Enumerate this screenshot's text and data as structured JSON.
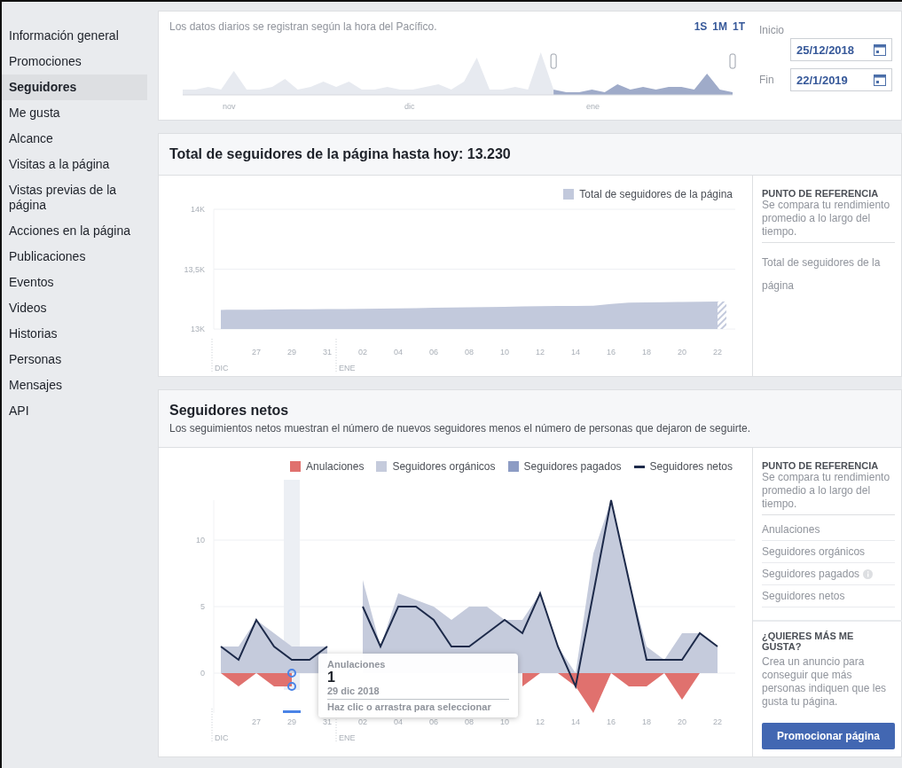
{
  "sidebar": {
    "items": [
      {
        "label": "Información general",
        "selected": false
      },
      {
        "label": "Promociones",
        "selected": false
      },
      {
        "label": "Seguidores",
        "selected": true
      },
      {
        "label": "Me gusta",
        "selected": false
      },
      {
        "label": "Alcance",
        "selected": false
      },
      {
        "label": "Visitas a la página",
        "selected": false
      },
      {
        "label": "Vistas previas de la página",
        "selected": false
      },
      {
        "label": "Acciones en la página",
        "selected": false
      },
      {
        "label": "Publicaciones",
        "selected": false
      },
      {
        "label": "Eventos",
        "selected": false
      },
      {
        "label": "Videos",
        "selected": false
      },
      {
        "label": "Historias",
        "selected": false
      },
      {
        "label": "Personas",
        "selected": false
      },
      {
        "label": "Mensajes",
        "selected": false
      },
      {
        "label": "API",
        "selected": false
      }
    ]
  },
  "range": {
    "note": "Los datos diarios se registran según la hora del Pacífico.",
    "presets": [
      {
        "label": "1S"
      },
      {
        "label": "1M"
      },
      {
        "label": "1T"
      }
    ],
    "months": [
      "nov",
      "dic",
      "ene"
    ],
    "start": {
      "label": "Inicio",
      "value": "25/12/2018"
    },
    "end": {
      "label": "Fin",
      "value": "22/1/2019"
    }
  },
  "total": {
    "title": "Total de seguidores de la página hasta hoy: 13.230",
    "month_labels": [
      "DIC",
      "ENE"
    ],
    "chart_data": {
      "type": "area",
      "categories": [
        null,
        null,
        "27",
        null,
        "29",
        null,
        "31",
        null,
        "02",
        null,
        "04",
        null,
        "06",
        null,
        "08",
        null,
        "10",
        null,
        "12",
        null,
        "14",
        null,
        "16",
        null,
        "18",
        null,
        "20",
        null,
        "22"
      ],
      "series": [
        {
          "name": "Total de seguidores de la página",
          "color": "#c2c9dc",
          "values": [
            13160,
            13161,
            13162,
            13163,
            13164,
            13165,
            13166,
            13167,
            13168,
            13170,
            13172,
            13175,
            13178,
            13180,
            13182,
            13184,
            13186,
            13188,
            13190,
            13192,
            13193,
            13195,
            13210,
            13220,
            13222,
            13224,
            13226,
            13228,
            13230
          ]
        }
      ],
      "ylim": [
        13000,
        14000
      ],
      "yticks": [
        {
          "value": 13000,
          "label": "13K"
        },
        {
          "value": 13500,
          "label": "13,5K"
        },
        {
          "value": 14000,
          "label": "14K"
        }
      ],
      "grid": true
    },
    "benchmark": {
      "title": "PUNTO DE REFERENCIA",
      "text": "Se compara tu rendimiento promedio a lo largo del tiempo.",
      "items": [
        {
          "label": "Total de seguidores de la página",
          "info": false
        }
      ]
    }
  },
  "net": {
    "title": "Seguidores netos",
    "subtitle": "Los seguimientos netos muestran el número de nuevos seguidores menos el número de personas que dejaron de seguirte.",
    "month_labels": [
      "DIC",
      "ENE"
    ],
    "chart_data": {
      "type": "area",
      "categories": [
        null,
        null,
        "27",
        null,
        "29",
        null,
        "31",
        null,
        "02",
        null,
        "04",
        null,
        "06",
        null,
        "08",
        null,
        "10",
        null,
        "12",
        null,
        "14",
        null,
        "16",
        null,
        "18",
        null,
        "20",
        null,
        "22"
      ],
      "series": [
        {
          "name": "Anulaciones",
          "color": "#e0716e",
          "values": [
            0,
            -1,
            0,
            -1,
            -1,
            null,
            null,
            null,
            null,
            null,
            null,
            null,
            null,
            null,
            null,
            null,
            null,
            -1,
            0,
            0,
            -1,
            -3,
            0,
            -1,
            -1,
            0,
            -2,
            0,
            0
          ]
        },
        {
          "name": "Seguidores orgánicos",
          "color": "#c5cbdc",
          "values": [
            2,
            2,
            4,
            3,
            2,
            2,
            2,
            null,
            7,
            2,
            6,
            5.5,
            5,
            4,
            5,
            5,
            4,
            4,
            6,
            2,
            0,
            9,
            13,
            7,
            2,
            1,
            3,
            3,
            2
          ]
        },
        {
          "name": "Seguidores pagados",
          "color": "#8d9cc4",
          "values": [
            null,
            null,
            null,
            null,
            null,
            null,
            null,
            null,
            null,
            null,
            null,
            null,
            null,
            null,
            null,
            null,
            null,
            null,
            null,
            null,
            null,
            null,
            null,
            null,
            null,
            null,
            null,
            null,
            null
          ]
        },
        {
          "name": "Seguidores netos",
          "type": "line",
          "color": "#1d2a4a",
          "values": [
            2,
            1,
            4,
            2,
            1,
            1,
            2,
            null,
            5,
            2,
            5,
            5,
            4,
            2,
            2,
            3,
            4,
            3,
            6,
            2,
            -1,
            6,
            13,
            7,
            1,
            1,
            1,
            3,
            2
          ]
        }
      ],
      "ylim": [
        -3,
        13
      ],
      "yticks": [
        0,
        5,
        10
      ],
      "grid": true
    },
    "tooltip": {
      "series": "Anulaciones",
      "value": "1",
      "date": "29 dic 2018",
      "hint": "Haz clic o arrastra para seleccionar"
    },
    "benchmark": {
      "title": "PUNTO DE REFERENCIA",
      "text": "Se compara tu rendimiento promedio a lo largo del tiempo.",
      "items": [
        {
          "label": "Anulaciones",
          "info": false
        },
        {
          "label": "Seguidores orgánicos",
          "info": false
        },
        {
          "label": "Seguidores pagados",
          "info": true
        },
        {
          "label": "Seguidores netos",
          "info": false
        }
      ]
    },
    "promo": {
      "title": "¿QUIERES MÁS ME GUSTA?",
      "text": "Crea un anuncio para conseguir que más personas indiquen que les gusta tu página.",
      "button": "Promocionar página"
    }
  }
}
